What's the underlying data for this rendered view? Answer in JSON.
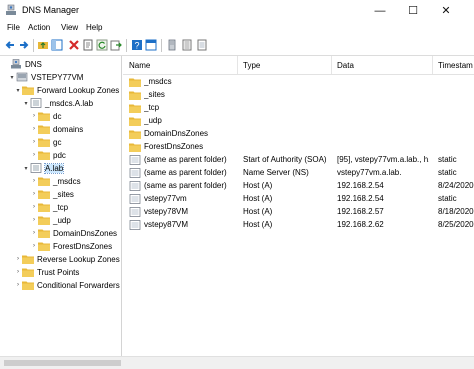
{
  "window": {
    "title": "DNS Manager",
    "minimize": "—",
    "maximize": "☐",
    "close": "✕"
  },
  "menu": [
    "File",
    "Action",
    "View",
    "Help"
  ],
  "toolbar_icons": [
    "back-arrow-icon",
    "forward-arrow-icon",
    "up-folder-icon",
    "show-tree-icon",
    "delete-icon",
    "properties-icon",
    "refresh-icon",
    "export-icon",
    "help-icon",
    "console-icon",
    "server-icon",
    "records-icon",
    "zone-icon"
  ],
  "tree": {
    "root": "DNS",
    "server": "VSTEPY77VM",
    "forward": "Forward Lookup Zones",
    "msdcs": "_msdcs.A.lab",
    "msdcs_children": [
      "dc",
      "domains",
      "gc",
      "pdc"
    ],
    "alab": "A.lab",
    "alab_children": [
      "_msdcs",
      "_sites",
      "_tcp",
      "_udp",
      "DomainDnsZones",
      "ForestDnsZones"
    ],
    "reverse": "Reverse Lookup Zones",
    "trust": "Trust Points",
    "conditional": "Conditional Forwarders"
  },
  "columns": {
    "name": "Name",
    "type": "Type",
    "data": "Data",
    "timestamp": "Timestam"
  },
  "rows": [
    {
      "icon": "folder",
      "name": "_msdcs",
      "type": "",
      "data": "",
      "ts": ""
    },
    {
      "icon": "folder",
      "name": "_sites",
      "type": "",
      "data": "",
      "ts": ""
    },
    {
      "icon": "folder",
      "name": "_tcp",
      "type": "",
      "data": "",
      "ts": ""
    },
    {
      "icon": "folder",
      "name": "_udp",
      "type": "",
      "data": "",
      "ts": ""
    },
    {
      "icon": "folder",
      "name": "DomainDnsZones",
      "type": "",
      "data": "",
      "ts": ""
    },
    {
      "icon": "folder",
      "name": "ForestDnsZones",
      "type": "",
      "data": "",
      "ts": ""
    },
    {
      "icon": "record",
      "name": "(same as parent folder)",
      "type": "Start of Authority (SOA)",
      "data": "[95], vstepy77vm.a.lab., h...",
      "ts": "static"
    },
    {
      "icon": "record",
      "name": "(same as parent folder)",
      "type": "Name Server (NS)",
      "data": "vstepy77vm.a.lab.",
      "ts": "static"
    },
    {
      "icon": "record",
      "name": "(same as parent folder)",
      "type": "Host (A)",
      "data": "192.168.2.54",
      "ts": "8/24/2020"
    },
    {
      "icon": "record",
      "name": "vstepy77vm",
      "type": "Host (A)",
      "data": "192.168.2.54",
      "ts": "static"
    },
    {
      "icon": "record",
      "name": "vstepy78VM",
      "type": "Host (A)",
      "data": "192.168.2.57",
      "ts": "8/18/2020"
    },
    {
      "icon": "record",
      "name": "vstepy87VM",
      "type": "Host (A)",
      "data": "192.168.2.62",
      "ts": "8/25/2020"
    }
  ],
  "colors": {
    "folder": "#e8b838",
    "folder_dark": "#c8961c",
    "selection": "#cce8ff",
    "accent": "#1c6fc7"
  }
}
